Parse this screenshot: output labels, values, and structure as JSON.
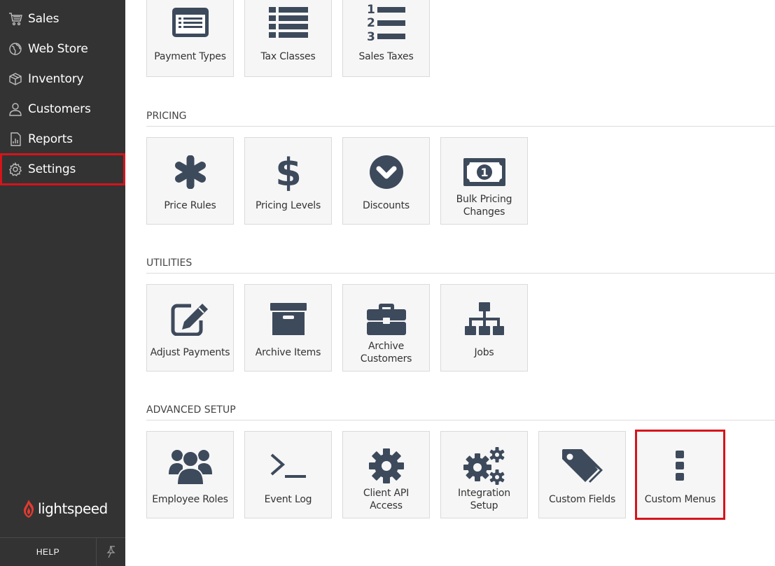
{
  "sidebar": {
    "items": [
      {
        "label": "Sales",
        "icon": "cart-icon"
      },
      {
        "label": "Web Store",
        "icon": "globe-icon"
      },
      {
        "label": "Inventory",
        "icon": "box-icon"
      },
      {
        "label": "Customers",
        "icon": "person-icon"
      },
      {
        "label": "Reports",
        "icon": "report-icon"
      },
      {
        "label": "Settings",
        "icon": "gear-icon",
        "active": true
      }
    ],
    "logo_text": "lightspeed",
    "help_label": "HELP"
  },
  "main": {
    "top_tiles": [
      {
        "label": "Payment Types",
        "icon": "payment-types-icon"
      },
      {
        "label": "Tax Classes",
        "icon": "list-icon"
      },
      {
        "label": "Sales Taxes",
        "icon": "numbered-list-icon"
      }
    ],
    "sections": [
      {
        "title": "PRICING",
        "tiles": [
          {
            "label": "Price Rules",
            "icon": "asterisk-icon"
          },
          {
            "label": "Pricing Levels",
            "icon": "dollar-icon"
          },
          {
            "label": "Discounts",
            "icon": "chevron-circle-icon"
          },
          {
            "label": "Bulk Pricing Changes",
            "icon": "money-bill-icon"
          }
        ]
      },
      {
        "title": "UTILITIES",
        "tiles": [
          {
            "label": "Adjust Payments",
            "icon": "edit-icon"
          },
          {
            "label": "Archive Items",
            "icon": "archive-icon"
          },
          {
            "label": "Archive Customers",
            "icon": "briefcase-icon"
          },
          {
            "label": "Jobs",
            "icon": "sitemap-icon"
          }
        ]
      },
      {
        "title": "ADVANCED SETUP",
        "tiles": [
          {
            "label": "Employee Roles",
            "icon": "users-icon"
          },
          {
            "label": "Event Log",
            "icon": "terminal-icon"
          },
          {
            "label": "Client API Access",
            "icon": "cog-icon"
          },
          {
            "label": "Integration Setup",
            "icon": "cogs-icon"
          },
          {
            "label": "Custom Fields",
            "icon": "tags-icon"
          },
          {
            "label": "Custom Menus",
            "icon": "vertical-dots-icon",
            "highlighted": true
          }
        ]
      }
    ]
  },
  "colors": {
    "sidebar_bg": "#333333",
    "highlight": "#d6141c",
    "icon": "#3d4a5c",
    "tile_bg": "#f6f6f6"
  }
}
